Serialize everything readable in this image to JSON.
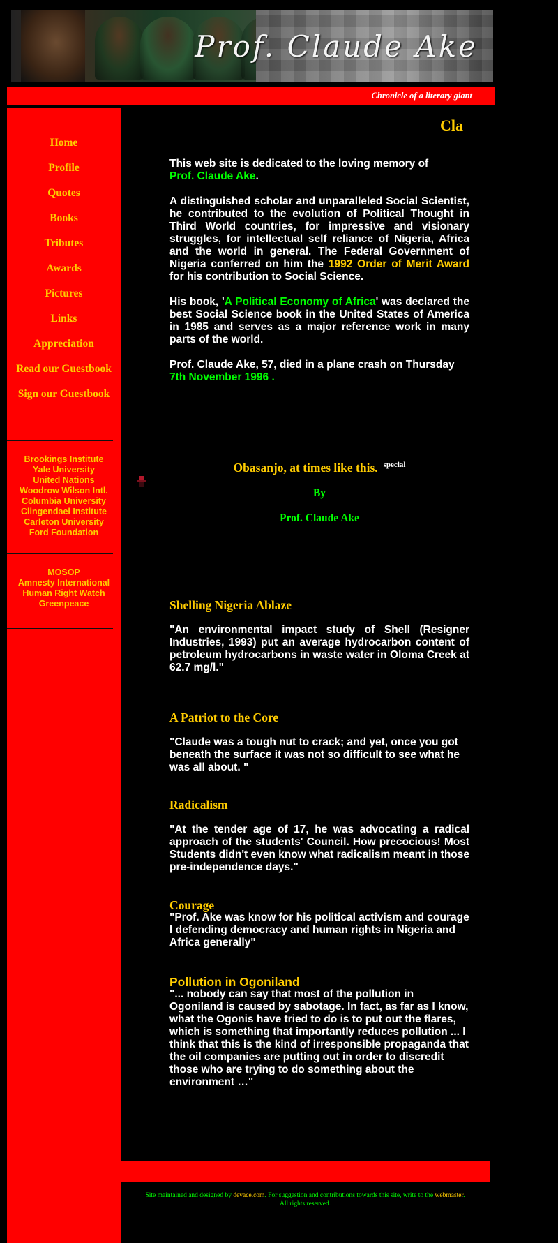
{
  "header": {
    "banner_title": "Prof. Claude Ake",
    "tagline": "Chronicle of a literary giant"
  },
  "nav": {
    "items": [
      {
        "label": "Home"
      },
      {
        "label": "Profile"
      },
      {
        "label": "Quotes"
      },
      {
        "label": "Books"
      },
      {
        "label": "Tributes"
      },
      {
        "label": "Awards"
      },
      {
        "label": "Pictures"
      },
      {
        "label": "Links"
      },
      {
        "label": "Appreciation"
      },
      {
        "label": "Read our Guestbook"
      },
      {
        "label": "Sign our Guestbook"
      }
    ]
  },
  "institutions": [
    "Brookings Institute",
    "Yale University",
    "United Nations",
    "Woodrow Wilson Intl.",
    "Columbia University",
    "Clingendael Institute",
    "Carleton University",
    "Ford Foundation"
  ],
  "organizations": [
    "MOSOP",
    "Amnesty International",
    "Human Right Watch",
    "Greenpeace"
  ],
  "marquee": "Cla",
  "intro": {
    "p1_text": "This web site is dedicated to the loving memory of",
    "p1_name": "Prof. Claude Ake",
    "p1_end": ".",
    "p2_text": "A distinguished scholar and unparalleled Social Scientist, he contributed to the evolution of Political Thought in Third World countries, for impressive and visionary struggles, for intellectual self reliance of Nigeria, Africa and the world in general. The Federal Government of Nigeria conferred on him the",
    "p2_award": "1992 Order of Merit Award",
    "p2_end": "for his contribution to Social Science.",
    "p3_start": "His book, '",
    "p3_book": "A Political Economy of Africa",
    "p3_end": "' was declared the best Social Science book in the United States of America in 1985 and serves as a major reference work in many parts of the world.",
    "p4_text": "Prof. Claude Ake, 57, died in a plane crash on Thursday",
    "p4_date": "7th November 1996 ."
  },
  "featured": {
    "title": "Obasanjo, at times like this.",
    "badge": "special",
    "by": "By",
    "author": "Prof. Claude Ake"
  },
  "sections": [
    {
      "heading": "Shelling Nigeria Ablaze",
      "body": "\"An environmental impact study of Shell (Resigner Industries, 1993) put an average hydrocarbon content of petroleum hydrocarbons in waste water in Oloma Creek at 62.7 mg/l.\""
    },
    {
      "heading": "A Patriot to the Core",
      "body": "\"Claude was a tough nut to crack; and yet, once you got beneath the surface it was not so difficult to see what he was all about. \""
    },
    {
      "heading": "Radicalism",
      "body": "\"At the tender age of 17, he was advocating a radical approach of the students' Council. How precocious! Most Students didn't even know what radicalism meant in those pre-independence days.\""
    },
    {
      "heading": "Courage",
      "body": "\"Prof. Ake was know for his political activism and courage I defending democracy and human rights in Nigeria and Africa generally\""
    },
    {
      "heading": "Pollution in Ogoniland",
      "body": "\"... nobody can say that most of the pollution in Ogoniland is caused by sabotage. In fact, as far as I know, what the Ogonis have tried to do is to put out the flares, which is something that importantly reduces pollution ... I think that this is the kind of irresponsible propaganda that the oil companies are putting out in order to discredit those who are trying to do something about the environment …\""
    }
  ],
  "footer": {
    "t1": "Site maintained and designed by",
    "link1": "devace.com",
    "t2": ". For suggestion and contributions towards this site, write to the",
    "link2": "webmaster",
    "t3": ".",
    "t4": "All rights reserved."
  },
  "colors": {
    "red": "#ff0000",
    "gold": "#ffcc00",
    "green": "#00ff00",
    "background": "#000000"
  }
}
